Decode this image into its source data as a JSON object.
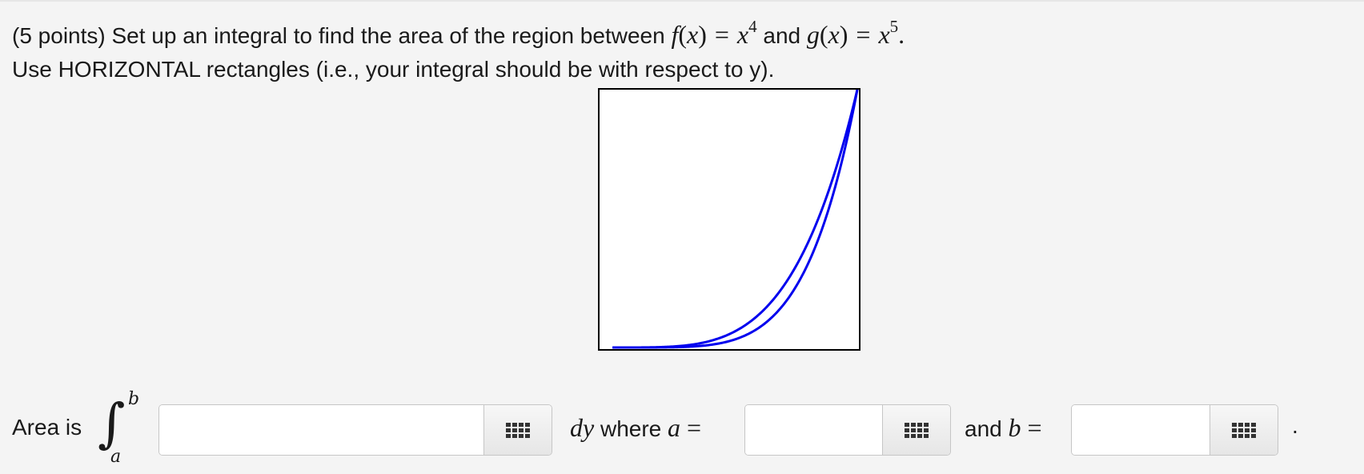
{
  "question": {
    "points": "(5 points)",
    "prompt_before_f": "Set up an integral to find the area of the region between",
    "f_name": "f",
    "g_name": "g",
    "var": "x",
    "f_exponent": "4",
    "g_exponent": "5",
    "and_text": "and",
    "line2": "Use HORIZONTAL rectangles (i.e., your integral should be with respect to y)."
  },
  "graph": {
    "curve_color": "#0000ee",
    "functions": [
      {
        "name": "f",
        "expression": "x^4",
        "exponent": 4
      },
      {
        "name": "g",
        "expression": "x^5",
        "exponent": 5
      }
    ]
  },
  "answer": {
    "area_label": "Area is",
    "integral_upper": "b",
    "integral_lower": "a",
    "dy": "dy",
    "where_text": "where",
    "a_var": "a",
    "and_text": "and",
    "b_var": "b",
    "equals": "=",
    "period": ".",
    "integrand_value": "",
    "a_value": "",
    "b_value": "",
    "keypad_icon": "keypad-grid-icon"
  }
}
